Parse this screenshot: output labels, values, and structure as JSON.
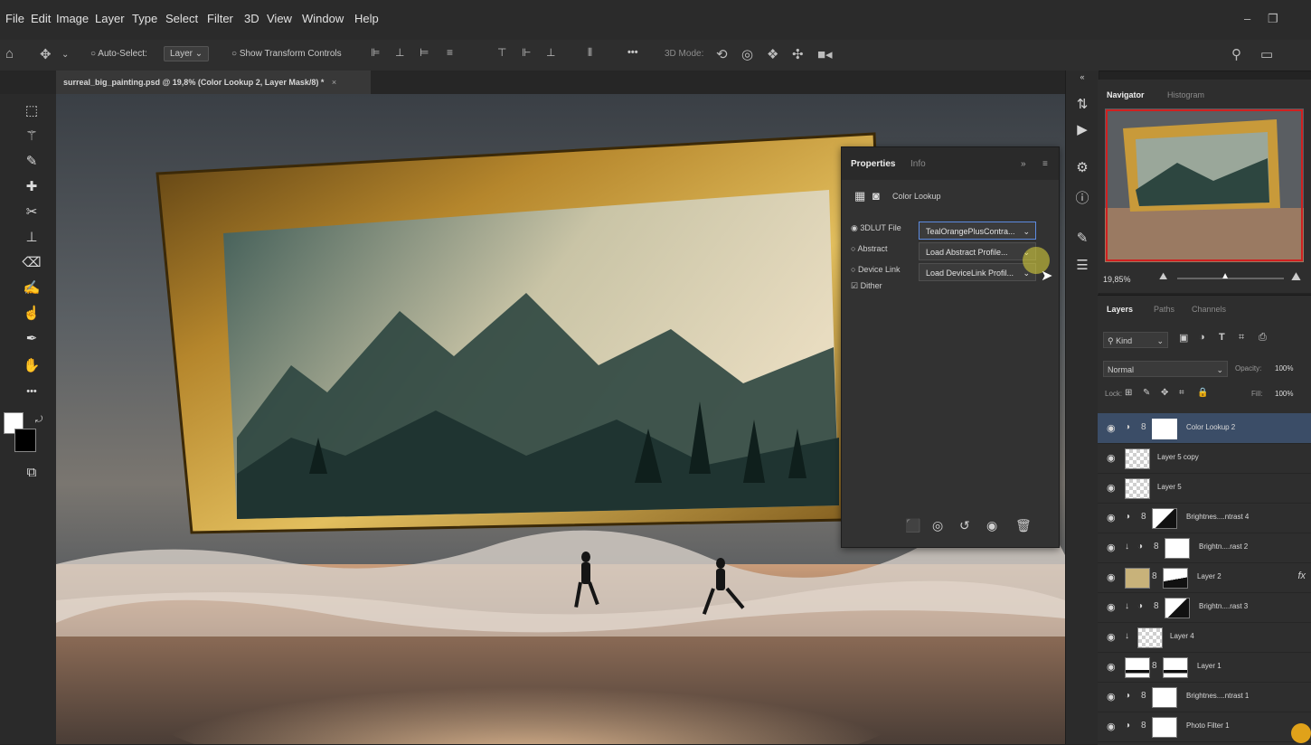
{
  "menu": [
    "File",
    "Edit",
    "Image",
    "Layer",
    "Type",
    "Select",
    "Filter",
    "3D",
    "View",
    "Window",
    "Help"
  ],
  "options_bar": {
    "auto_select_label": "Auto-Select:",
    "auto_select_value": "Layer",
    "show_transform_label": "Show Transform Controls",
    "more": "•••",
    "mode_3d_label": "3D Mode:"
  },
  "document_tab": {
    "title": "surreal_big_painting.psd @ 19,8% (Color Lookup 2, Layer Mask/8) *",
    "close": "×"
  },
  "properties": {
    "tabs": [
      "Properties",
      "Info"
    ],
    "header_label": "Color Lookup",
    "options": [
      {
        "label": "3DLUT File",
        "value": "TealOrangePlusContra...",
        "selected": true
      },
      {
        "label": "Abstract",
        "value": "Load Abstract Profile...",
        "selected": false
      },
      {
        "label": "Device Link",
        "value": "Load DeviceLink Profil...",
        "selected": false
      }
    ],
    "dither_label": "Dither",
    "dither_checked": true
  },
  "navigator": {
    "tabs": [
      "Navigator",
      "Histogram"
    ],
    "zoom": "19,85%",
    "zoom_slider_fraction": 0.45
  },
  "layers_panel": {
    "tabs": [
      "Layers",
      "Paths",
      "Channels"
    ],
    "filter_label": "Kind",
    "blend_mode": "Normal",
    "opacity_label": "Opacity:",
    "opacity": "100%",
    "lock_label": "Lock:",
    "fill_label": "Fill:",
    "fill": "100%",
    "layers": [
      {
        "name": "Color Lookup 2",
        "thumb": "white",
        "adj": true,
        "link": true,
        "clip": false,
        "selected": true,
        "fx": false
      },
      {
        "name": "Layer 5 copy",
        "thumb": "checker",
        "adj": false,
        "link": false,
        "clip": false,
        "selected": false,
        "fx": false
      },
      {
        "name": "Layer 5",
        "thumb": "checker",
        "adj": false,
        "link": false,
        "clip": false,
        "selected": false,
        "fx": false
      },
      {
        "name": "Brightnes....ntrast 4",
        "thumb": "diagonal",
        "adj": true,
        "link": true,
        "clip": false,
        "selected": false,
        "fx": false
      },
      {
        "name": "Brightn....rast 2",
        "thumb": "white",
        "adj": true,
        "link": true,
        "clip": true,
        "selected": false,
        "fx": false
      },
      {
        "name": "Layer 2",
        "thumb": "wave",
        "adj": false,
        "link": true,
        "clip": false,
        "selected": false,
        "fx": true
      },
      {
        "name": "Brightn....rast 3",
        "thumb": "diagonal",
        "adj": true,
        "link": true,
        "clip": true,
        "selected": false,
        "fx": false
      },
      {
        "name": "Layer 4",
        "thumb": "checker",
        "adj": false,
        "link": false,
        "clip": true,
        "selected": false,
        "fx": false
      },
      {
        "name": "Layer 1",
        "thumb": "bar",
        "adj": false,
        "link": true,
        "clip": false,
        "selected": false,
        "fx": false
      },
      {
        "name": "Brightnes....ntrast 1",
        "thumb": "white",
        "adj": true,
        "link": true,
        "clip": false,
        "selected": false,
        "fx": false
      },
      {
        "name": "Photo Filter 1",
        "thumb": "white",
        "adj": true,
        "link": true,
        "clip": false,
        "selected": false,
        "fx": false
      }
    ]
  }
}
